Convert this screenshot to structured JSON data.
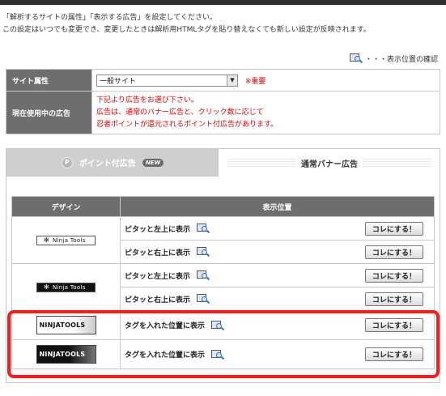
{
  "intro": {
    "line1": "「解析するサイトの属性」「表示する広告」を設定してください。",
    "line2": "この設定はいつでも変更でき、変更したときは解析用HTMLタグを貼り替えなくても新しい設定が反映されます。"
  },
  "preview": {
    "label": "・・・表示位置の確認",
    "icon": "magnifier-screen-icon"
  },
  "settings": {
    "site_attr_label": "サイト属性",
    "site_attr_value": "一般サイト",
    "required": "※重要",
    "current_ad_label": "現在使用中の広告",
    "notice": [
      "下記より広告をお選び下さい。",
      "広告は、通常のバナー広告と、クリック数に応じて",
      "忍者ポイントが還元されるポイント付広告があります。"
    ]
  },
  "tabs": {
    "points": {
      "label": "ポイント付広告",
      "badge": "NEW",
      "icon": "coin-p-icon"
    },
    "banner": {
      "label": "通常バナー広告"
    }
  },
  "table": {
    "headers": [
      "デザイン",
      "表示位置"
    ],
    "logo_text_small": "Ninja Tools",
    "logo_text_big": "NINJATOOLS",
    "button_label": "コレにする！",
    "rows": [
      {
        "position": "ピタッと左上に表示"
      },
      {
        "position": "ピタッと右上に表示"
      },
      {
        "position": "ピタッと左上に表示"
      },
      {
        "position": "ピタッと右上に表示"
      },
      {
        "position": "タグを入れた位置に表示"
      },
      {
        "position": "タグを入れた位置に表示"
      }
    ]
  },
  "colors": {
    "header_gray": "#6e6e6e",
    "highlight": "#ff1a1a",
    "notice_red": "#e00000"
  }
}
